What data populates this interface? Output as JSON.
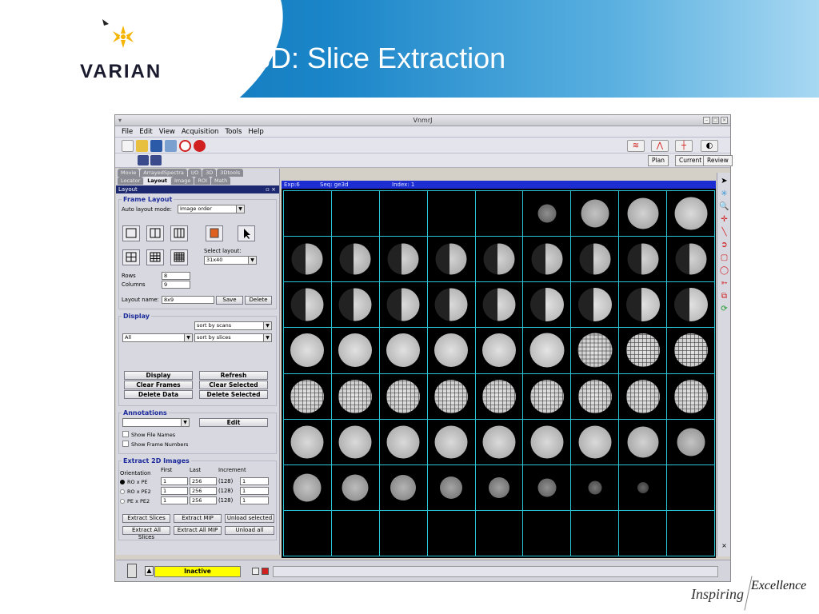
{
  "slide": {
    "title": "3D: Slice Extraction",
    "brand": "VARIAN",
    "footer_left": "Inspiring",
    "footer_right": "Excellence"
  },
  "window": {
    "title": "VnmrJ",
    "menu": [
      "File",
      "Edit",
      "View",
      "Acquisition",
      "Tools",
      "Help"
    ],
    "toolbar2_buttons": [
      "Plan",
      "Current",
      "Review"
    ]
  },
  "left_panel": {
    "tabs_row1": [
      "Movie",
      "ArrayedSpectra",
      "I/O",
      "3D",
      "3Dtools"
    ],
    "tabs_row2": [
      "Locator",
      "Layout",
      "Image",
      "ROI",
      "Math"
    ],
    "active_tab": "Layout",
    "panel_title": "Layout",
    "frame_layout": {
      "title": "Frame Layout",
      "auto_layout_label": "Auto layout mode:",
      "auto_layout_value": "Image order",
      "select_layout_label": "Select layout:",
      "select_layout_value": "31x40",
      "rows_label": "Rows",
      "rows_value": "8",
      "columns_label": "Columns",
      "columns_value": "9",
      "layout_name_label": "Layout name:",
      "layout_name_value": "8x9",
      "save_label": "Save",
      "delete_label": "Delete"
    },
    "display": {
      "title": "Display",
      "sort1": "sort by scans",
      "filter": "All",
      "sort2": "sort by slices",
      "display_btn": "Display",
      "refresh_btn": "Refresh",
      "clear_frames_btn": "Clear Frames",
      "clear_selected_btn": "Clear Selected",
      "delete_data_btn": "Delete Data",
      "delete_selected_btn": "Delete Selected"
    },
    "annotations": {
      "title": "Annotations",
      "edit_btn": "Edit",
      "show_file_names": "Show File Names",
      "show_frame_numbers": "Show Frame Numbers"
    },
    "extract": {
      "title": "Extract 2D Images",
      "col_orientation": "Orientation",
      "col_first": "First",
      "col_last": "Last",
      "col_increment": "Increment",
      "rows": [
        {
          "label": "RO x PE",
          "first": "1",
          "last": "256",
          "count": "(128)",
          "inc": "1",
          "selected": true
        },
        {
          "label": "RO x PE2",
          "first": "1",
          "last": "256",
          "count": "(128)",
          "inc": "1",
          "selected": false
        },
        {
          "label": "PE x PE2",
          "first": "1",
          "last": "256",
          "count": "(128)",
          "inc": "1",
          "selected": false
        }
      ],
      "extract_slices_btn": "Extract Slices",
      "extract_mip_btn": "Extract MIP",
      "unload_selected_btn": "Unload selected",
      "extract_all_slices_btn": "Extract All Slices",
      "extract_all_mip_btn": "Extract All MIP",
      "unload_all_btn": "Unload all"
    }
  },
  "viewer": {
    "exp": "Exp:6",
    "seq": "Seq: ge3d",
    "index": "Index: 1",
    "grid_cols": 9,
    "grid_rows": 8
  },
  "status": {
    "state": "Inactive"
  }
}
